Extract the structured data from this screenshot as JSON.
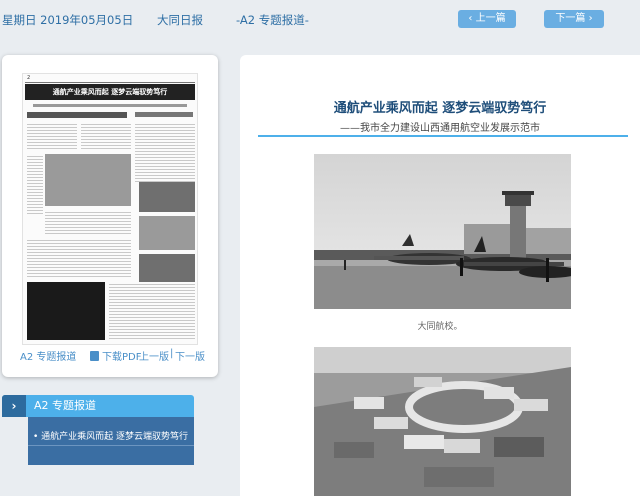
{
  "header": {
    "date": "星期日 2019年05月05日",
    "paper_name": "大同日报",
    "page_label": "-A2 专题报道-",
    "prev_label": "上一篇",
    "next_label": "下一篇"
  },
  "thumbnail": {
    "page_no": "2",
    "headline": "通航产业乘风而起 逐梦云端驭势笃行",
    "page_label": "A2 专题报道",
    "pdf_label": "下载PDF",
    "prev_page": "上一版",
    "separator": "|",
    "next_page": "下一版"
  },
  "section": {
    "title": "A2 专题报道",
    "items": [
      "通航产业乘风而起 逐梦云端驭势笃行"
    ]
  },
  "article": {
    "title": "通航产业乘风而起 逐梦云端驭势笃行",
    "subtitle": "——我市全力建设山西通用航空业发展示范市",
    "photo1_caption": "大同航校。"
  },
  "colors": {
    "accent": "#4db0ea",
    "accent_dark": "#2d6b9e",
    "link": "#2e6fa5"
  },
  "icons": {
    "prev": "chevron-left-icon",
    "next": "chevron-right-icon",
    "pdf": "pdf-icon",
    "section": "chevron-right-icon"
  }
}
